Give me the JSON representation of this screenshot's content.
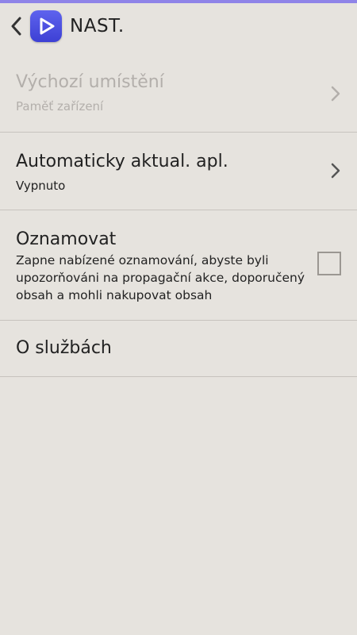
{
  "header": {
    "title": "NAST.",
    "back_icon": "chevron-left-icon",
    "app_icon": "play-triangle-icon",
    "accent_color": "#8f84e8"
  },
  "settings": {
    "default_location": {
      "title": "Výchozí umístění",
      "value": "Paměť zařízení",
      "enabled": false
    },
    "auto_update": {
      "title": "Automaticky aktual. apl.",
      "value": "Vypnuto"
    },
    "notify": {
      "title": "Oznamovat",
      "description": "Zapne nabízené oznamování, abyste byli upozorňováni na propagační akce, doporučený obsah a mohli nakupovat obsah",
      "checked": false
    },
    "about": {
      "title": "O službách"
    }
  }
}
